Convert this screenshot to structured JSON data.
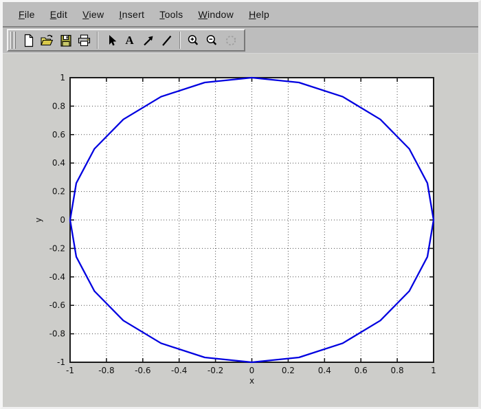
{
  "app": {
    "name": "figure-window"
  },
  "menu": {
    "items": [
      {
        "label": "File"
      },
      {
        "label": "Edit"
      },
      {
        "label": "View"
      },
      {
        "label": "Insert"
      },
      {
        "label": "Tools"
      },
      {
        "label": "Window"
      },
      {
        "label": "Help"
      }
    ]
  },
  "toolbar": {
    "buttons": [
      {
        "icon": "new-icon",
        "tool": "new figure"
      },
      {
        "icon": "open-icon",
        "tool": "open file"
      },
      {
        "icon": "save-icon",
        "tool": "save figure"
      },
      {
        "icon": "print-icon",
        "tool": "print figure"
      },
      {
        "icon": "pointer-icon",
        "tool": "edit plot"
      },
      {
        "icon": "text-icon",
        "tool": "insert text",
        "glyph": "A"
      },
      {
        "icon": "arrow-icon",
        "tool": "insert arrow"
      },
      {
        "icon": "line-icon",
        "tool": "insert line"
      },
      {
        "icon": "zoom-in-icon",
        "tool": "zoom in"
      },
      {
        "icon": "zoom-out-icon",
        "tool": "zoom out"
      },
      {
        "icon": "rotate3d-icon",
        "tool": "rotate 3d",
        "disabled": true
      }
    ]
  },
  "colors": {
    "chrome_gray": "#bdbdbd",
    "canvas_gray": "#cdcdca",
    "plot_background": "#ffffff",
    "axis_color": "#1a1a1a",
    "grid_color": "#4a4a4a",
    "line_blue": "#0000e0",
    "folder_yellow": "#d8c84a"
  },
  "chart_data": {
    "type": "line",
    "title": "",
    "xlabel": "x",
    "ylabel": "y",
    "xlim": [
      -1,
      1
    ],
    "ylim": [
      -1,
      1
    ],
    "xticks": [
      -1,
      -0.8,
      -0.6,
      -0.4,
      -0.2,
      0,
      0.2,
      0.4,
      0.6,
      0.8,
      1
    ],
    "xtick_labels": [
      "-1",
      "-0.8",
      "-0.6",
      "-0.4",
      "-0.2",
      "0",
      "0.2",
      "0.4",
      "0.6",
      "0.8",
      "1"
    ],
    "yticks": [
      -1,
      -0.8,
      -0.6,
      -0.4,
      -0.2,
      0,
      0.2,
      0.4,
      0.6,
      0.8,
      1
    ],
    "ytick_labels": [
      "-1",
      "-0.8",
      "-0.6",
      "-0.4",
      "-0.2",
      "0",
      "0.2",
      "0.4",
      "0.6",
      "0.8",
      "1"
    ],
    "grid": true,
    "grid_style": "dotted",
    "box": true,
    "legend": null,
    "series": [
      {
        "name": "unit-circle",
        "color": "#0000e0",
        "description": "unit circle, x = cos(t), y = sin(t)",
        "x": [
          1,
          0.966,
          0.866,
          0.707,
          0.5,
          0.259,
          0,
          -0.259,
          -0.5,
          -0.707,
          -0.866,
          -0.966,
          -1,
          -0.966,
          -0.866,
          -0.707,
          -0.5,
          -0.259,
          0,
          0.259,
          0.5,
          0.707,
          0.866,
          0.966,
          1
        ],
        "y": [
          0,
          0.259,
          0.5,
          0.707,
          0.866,
          0.966,
          1,
          0.966,
          0.866,
          0.707,
          0.5,
          0.259,
          0,
          -0.259,
          -0.5,
          -0.707,
          -0.866,
          -0.966,
          -1,
          -0.966,
          -0.866,
          -0.707,
          -0.5,
          -0.259,
          0
        ]
      }
    ]
  }
}
